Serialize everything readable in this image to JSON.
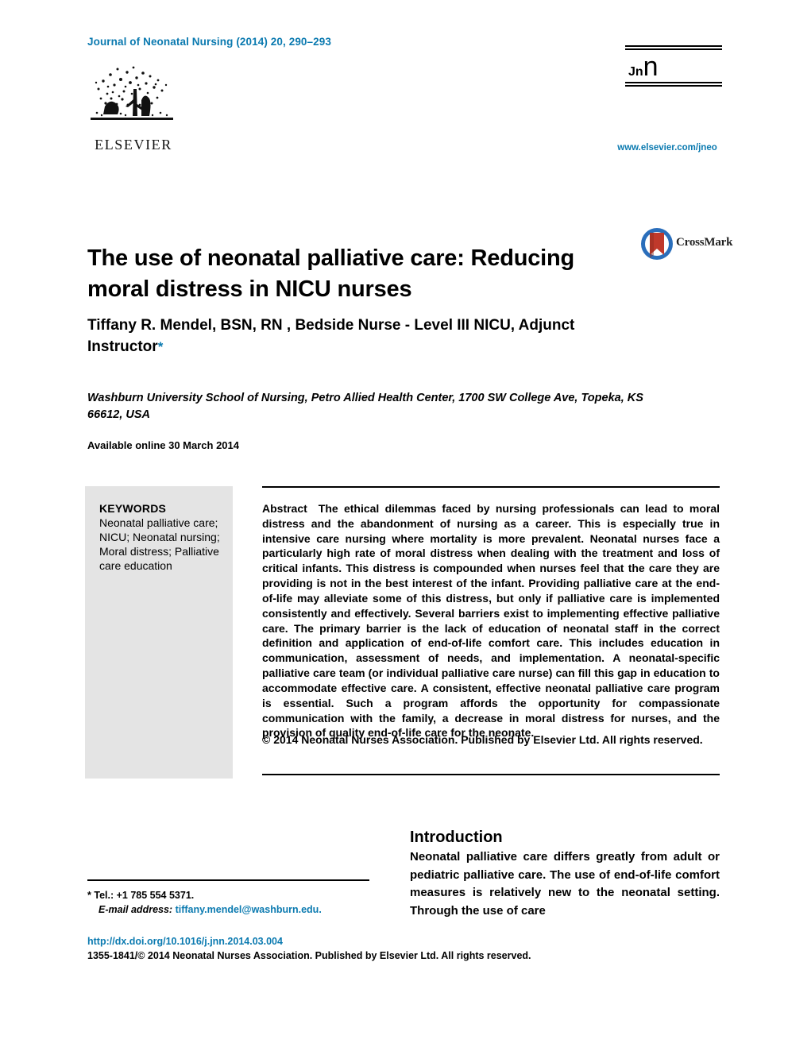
{
  "header": {
    "journal_reference": "Journal of Neonatal Nursing (2014) 20, 290–293",
    "journal_url": "www.elsevier.com/jneo",
    "publisher_name": "ELSEVIER",
    "journal_mark_main": "Jn",
    "journal_mark_sub": "n"
  },
  "badge": {
    "crossmark_label": "CrossMark"
  },
  "article": {
    "title": "The use of neonatal palliative care: Reducing moral distress in NICU nurses",
    "authors": "Tiffany R. Mendel, BSN, RN , Bedside Nurse - Level III NICU, Adjunct Instructor",
    "author_footnote_marker": "*",
    "affiliation": "Washburn University School of Nursing, Petro Allied Health Center, 1700 SW College Ave, Topeka, KS 66612, USA",
    "available_online": "Available online 30 March 2014"
  },
  "keywords": {
    "heading": "KEYWORDS",
    "list": "Neonatal palliative care; NICU; Neonatal nursing; Moral distress; Palliative care education"
  },
  "abstract": {
    "label": "Abstract",
    "text": "The ethical dilemmas faced by nursing professionals can lead to moral distress and the abandonment of nursing as a career. This is especially true in intensive care nursing where mortality is more prevalent. Neonatal nurses face a particularly high rate of moral distress when dealing with the treatment and loss of critical infants. This distress is compounded when nurses feel that the care they are providing is not in the best interest of the infant. Providing palliative care at the end-of-life may alleviate some of this distress, but only if palliative care is implemented consistently and effectively. Several barriers exist to implementing effective palliative care. The primary barrier is the lack of education of neonatal staff in the correct definition and application of end-of-life comfort care. This includes education in communication, assessment of needs, and implementation. A neonatal-specific palliative care team (or individual palliative care nurse) can fill this gap in education to accommodate effective care. A consistent, effective neonatal palliative care program is essential. Such a program affords the opportunity for compassionate communication with the family, a decrease in moral distress for nurses, and the provision of quality end-of-life care for the neonate.",
    "copyright": "© 2014 Neonatal Nurses Association. Published by Elsevier Ltd. All rights reserved."
  },
  "introduction": {
    "heading": "Introduction",
    "body": "Neonatal palliative care differs greatly from adult or pediatric palliative care. The use of end-of-life comfort measures is relatively new to the neonatal setting. Through the use of care"
  },
  "footnote": {
    "marker": "*",
    "telephone": "Tel.: +1 785 554 5371.",
    "email_label": "E-mail address:",
    "email": "tiffany.mendel@washburn.edu",
    "email_trailing": "."
  },
  "bottom": {
    "doi": "http://dx.doi.org/10.1016/j.jnn.2014.03.004",
    "issn_line": "1355-1841/© 2014 Neonatal Nurses Association. Published by Elsevier Ltd. All rights reserved."
  },
  "colors": {
    "accent_blue": "#0b7ab0",
    "keywords_background": "#e4e4e4",
    "crossmark_blue": "#2a6ebb",
    "crossmark_red": "#c0392b"
  }
}
